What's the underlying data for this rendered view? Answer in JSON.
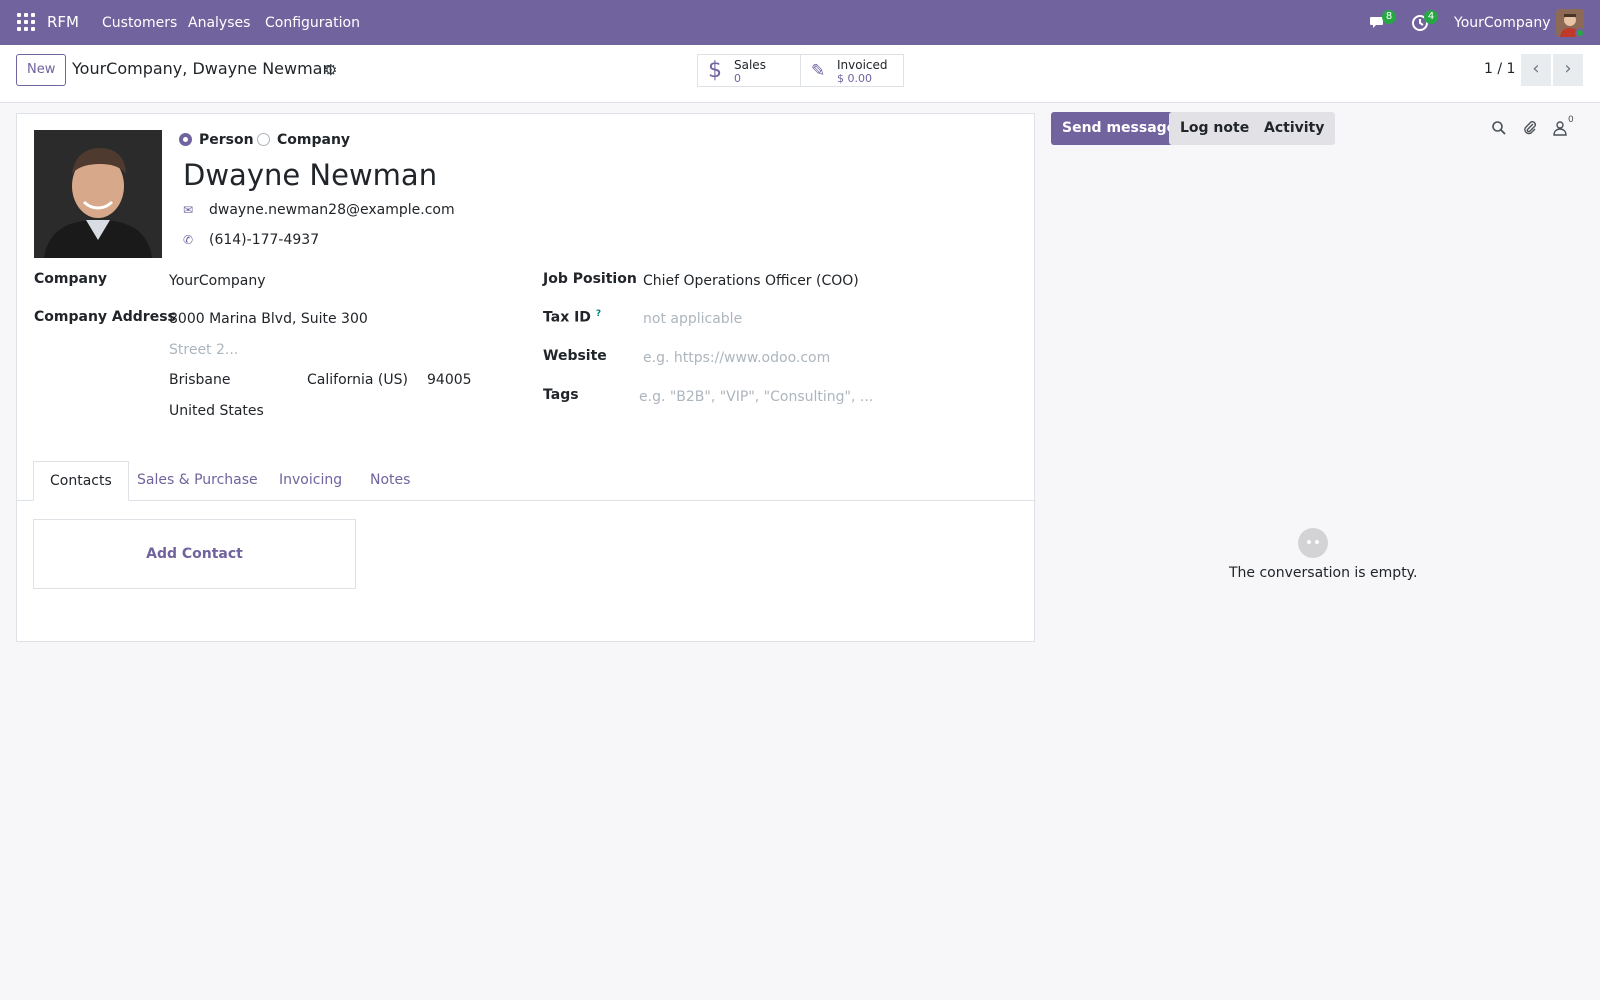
{
  "navbar": {
    "brand": "RFM",
    "menus": [
      "Customers",
      "Analyses",
      "Configuration"
    ],
    "messages_count": "8",
    "activities_count": "4",
    "company": "YourCompany"
  },
  "control": {
    "new_label": "New",
    "breadcrumb": "YourCompany, Dwayne Newman",
    "stats": [
      {
        "label": "Sales",
        "value": "0",
        "icon": "dollar-icon"
      },
      {
        "label": "Invoiced",
        "value": "$ 0.00",
        "icon": "invoice-edit-icon"
      }
    ],
    "pager": "1 / 1"
  },
  "form": {
    "type_options": [
      "Person",
      "Company"
    ],
    "selected_type": "Person",
    "name": "Dwayne Newman",
    "email": "dwayne.newman28@example.com",
    "phone": "(614)-177-4937",
    "company_label": "Company",
    "company_value": "YourCompany",
    "address_label": "Company Address",
    "street": "8000 Marina Blvd, Suite 300",
    "street2_placeholder": "Street 2...",
    "city": "Brisbane",
    "state": "California (US)",
    "zip": "94005",
    "country": "United States",
    "job_label": "Job Position",
    "job_value": "Chief Operations Officer (COO)",
    "taxid_label": "Tax ID",
    "taxid_help": "?",
    "taxid_placeholder": "not applicable",
    "website_label": "Website",
    "website_placeholder": "e.g. https://www.odoo.com",
    "tags_label": "Tags",
    "tags_placeholder": "e.g. \"B2B\", \"VIP\", \"Consulting\", ..."
  },
  "tabs": [
    "Contacts",
    "Sales & Purchase",
    "Invoicing",
    "Notes"
  ],
  "active_tab": "Contacts",
  "add_contact_label": "Add Contact",
  "chatter": {
    "send_message": "Send message",
    "log_note": "Log note",
    "activity": "Activity",
    "followers_count": "0",
    "empty_text": "The conversation is empty."
  },
  "colors": {
    "brand": "#71639e",
    "badge": "#28a745"
  }
}
